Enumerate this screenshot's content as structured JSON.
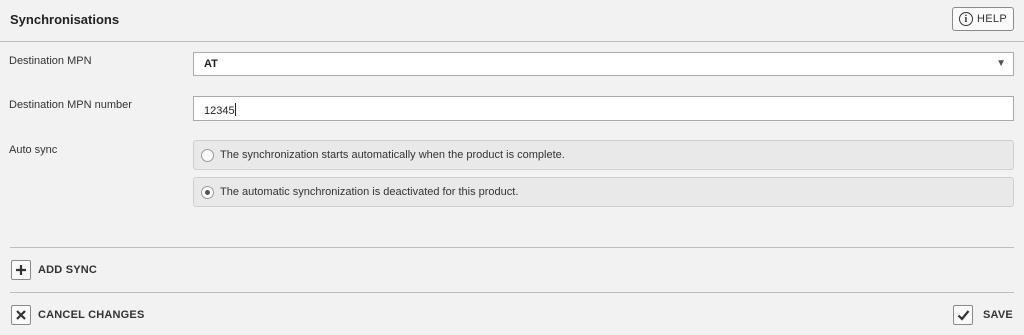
{
  "header": {
    "title": "Synchronisations",
    "help_label": "HELP"
  },
  "form": {
    "destination_mpn": {
      "label": "Destination MPN",
      "value": "AT"
    },
    "destination_mpn_number": {
      "label": "Destination MPN number",
      "value": "12345"
    },
    "auto_sync": {
      "label": "Auto sync",
      "options": [
        {
          "label": "The synchronization starts automatically when the product is complete.",
          "selected": false
        },
        {
          "label": "The automatic synchronization is deactivated for this product.",
          "selected": true
        }
      ]
    }
  },
  "actions": {
    "add_sync": "ADD SYNC",
    "cancel_changes": "CANCEL CHANGES",
    "save": "SAVE"
  }
}
